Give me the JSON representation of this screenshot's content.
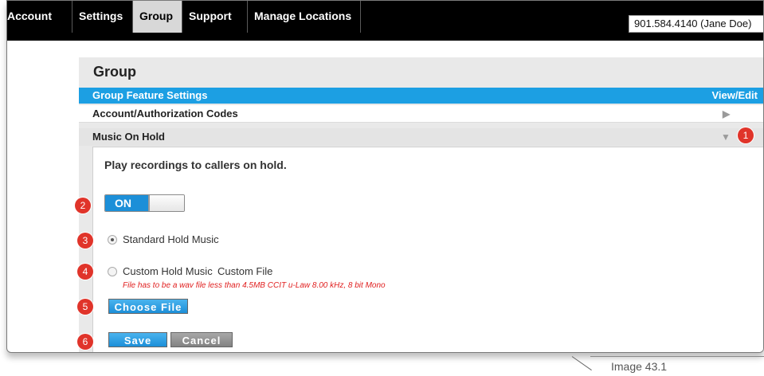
{
  "nav": {
    "tabs": [
      "Account",
      "Settings",
      "Group",
      "Support",
      "Manage Locations"
    ],
    "active_tab": "Group",
    "phone_select": "901.584.4140 (Jane Doe)"
  },
  "group": {
    "title": "Group",
    "feature_bar": {
      "label": "Group Feature Settings",
      "action": "View/Edit"
    },
    "rows": [
      {
        "label": "Account/Authorization Codes",
        "arrow": "▶"
      },
      {
        "label": "Music On Hold",
        "arrow": "▼"
      }
    ],
    "music_on_hold": {
      "description": "Play recordings to callers on hold.",
      "toggle_label": "ON",
      "standard_label": "Standard Hold Music",
      "custom_label": "Custom Hold Music",
      "custom_file_label": "Custom File",
      "file_note": "File has to be a wav file less than 4.5MB CCIT u-Law 8.00 kHz, 8 bit Mono",
      "choose_file_label": "Choose File",
      "save_label": "Save",
      "cancel_label": "Cancel"
    }
  },
  "callouts": [
    "1",
    "2",
    "3",
    "4",
    "5",
    "6"
  ],
  "caption": "Image 43.1",
  "colors": {
    "accent_blue": "#1c9fe3",
    "badge_red": "#e0342a",
    "note_red": "#e02020"
  }
}
